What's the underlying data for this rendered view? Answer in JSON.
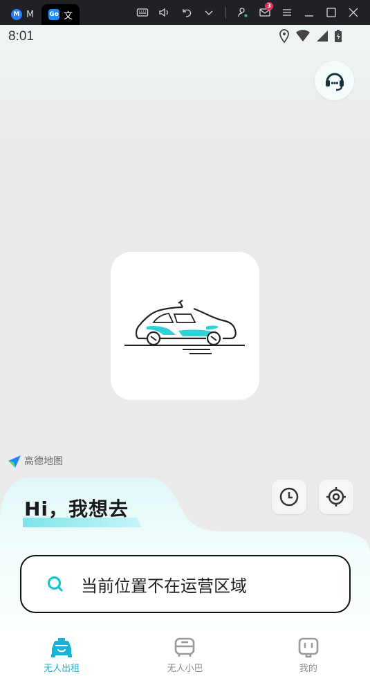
{
  "window": {
    "tabs": [
      {
        "label": "M",
        "icon": "app-m-icon"
      },
      {
        "label": "文",
        "icon": "app-go-icon"
      }
    ],
    "mail_count": "3"
  },
  "status_bar": {
    "time": "8:01"
  },
  "map": {
    "provider_logo_text": "高德地图"
  },
  "home": {
    "greeting": "Hi，我想去",
    "search_text": "当前位置不在运营区域"
  },
  "tabbar": {
    "tabs": [
      {
        "label": "无人出租",
        "icon": "taxi-icon",
        "active": true
      },
      {
        "label": "无人小巴",
        "icon": "bus-icon",
        "active": false
      },
      {
        "label": "我的",
        "icon": "profile-icon",
        "active": false
      }
    ]
  },
  "colors": {
    "accent": "#1bb7d6",
    "accent_light": "#7fe4ea",
    "titlebar": "#1f2126"
  }
}
